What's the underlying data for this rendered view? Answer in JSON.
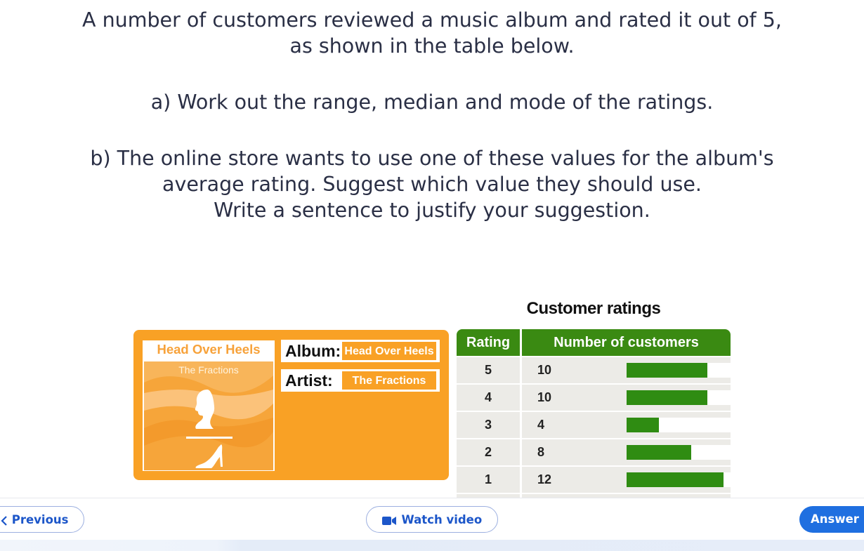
{
  "question": {
    "line1": "A number of customers reviewed a music album and rated it out of 5,",
    "line2": "as shown in the table below.",
    "part_a": "a) Work out the range, median and mode of the ratings.",
    "part_b_1": "b) The online store wants to use one of these values for the album's",
    "part_b_2": "average rating. Suggest which value they should use.",
    "part_b_3": "Write a sentence to justify your suggestion."
  },
  "album": {
    "cover_title": "Head Over Heels",
    "cover_artist": "The Fractions",
    "album_label": "Album:",
    "album_value": "Head Over Heels",
    "artist_label": "Artist:",
    "artist_value": "The Fractions"
  },
  "table": {
    "title": "Customer ratings",
    "header_rating": "Rating",
    "header_count": "Number of customers",
    "rows": [
      {
        "rating": "5",
        "count": "10",
        "fill": 0.5
      },
      {
        "rating": "4",
        "count": "10",
        "fill": 0.5
      },
      {
        "rating": "3",
        "count": "4",
        "fill": 0.2
      },
      {
        "rating": "2",
        "count": "8",
        "fill": 0.4
      },
      {
        "rating": "1",
        "count": "12",
        "fill": 0.6
      }
    ],
    "bar_color": "#2f8c12",
    "header_color": "#3a8a12"
  },
  "nav": {
    "previous": "Previous",
    "watch_video": "Watch video",
    "answer": "Answer",
    "icons": {
      "previous": "chevron-left-icon",
      "video": "video-camera-icon"
    },
    "accent": "#1f6fe0"
  }
}
